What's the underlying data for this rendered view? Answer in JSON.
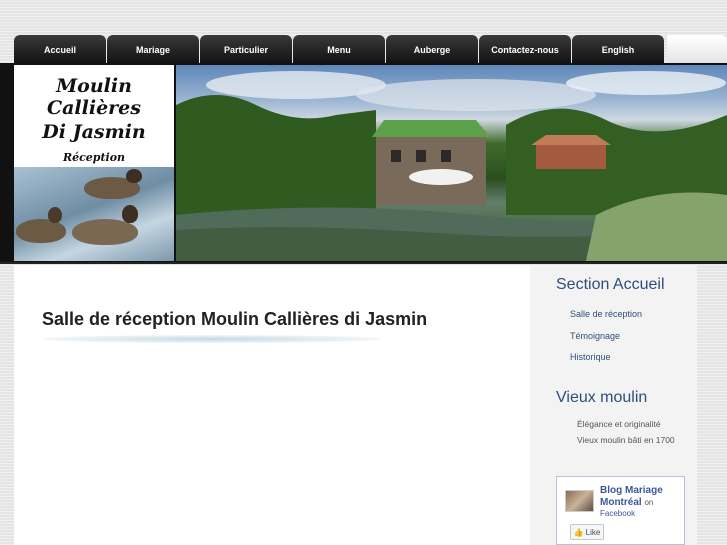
{
  "nav": {
    "items": [
      {
        "label": "Accueil"
      },
      {
        "label": "Mariage"
      },
      {
        "label": "Particulier"
      },
      {
        "label": "Menu"
      },
      {
        "label": "Auberge"
      },
      {
        "label": "Contactez-nous"
      },
      {
        "label": "English"
      }
    ]
  },
  "banner": {
    "logo_line1": "Moulin Callières",
    "logo_line2": "Di Jasmin",
    "logo_line3": "Réception"
  },
  "main": {
    "title": "Salle de réception Moulin Callières di Jasmin"
  },
  "sidebar": {
    "section1_heading": "Section Accueil",
    "section1_links": [
      "Salle de réception",
      "Témoignage",
      "Historique"
    ],
    "section2_heading": "Vieux moulin",
    "section2_lines": [
      "Élégance et originalité",
      "Vieux moulin bâti en 1700"
    ],
    "facebook": {
      "name": "Blog Mariage Montréal",
      "on": "on",
      "sub": "Facebook",
      "like_label": "Like"
    }
  },
  "colors": {
    "nav_bg": "#1a1a1a",
    "link": "#2d4f7c",
    "facebook": "#3b5998"
  }
}
